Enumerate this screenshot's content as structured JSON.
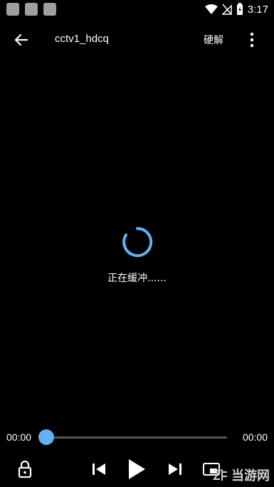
{
  "status_bar": {
    "time": "3:17"
  },
  "header": {
    "title": "cctv1_hdcq",
    "decoder_label": "硬解"
  },
  "player": {
    "buffering_text": "正在缓冲......",
    "current_time": "00:00",
    "duration": "00:00",
    "progress": 0
  },
  "controls": {
    "icons": [
      "lock-icon",
      "previous-icon",
      "play-icon",
      "next-icon",
      "picture-in-picture-icon"
    ]
  },
  "watermark": {
    "text": "当游网"
  },
  "colors": {
    "background": "#000000",
    "accent": "#64b0f2"
  }
}
